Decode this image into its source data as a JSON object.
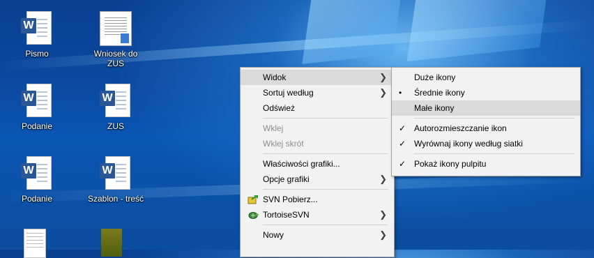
{
  "desktop_icons": [
    {
      "label": "Pismo",
      "kind": "word"
    },
    {
      "label": "Wniosek do ZUS",
      "kind": "preview"
    },
    {
      "label": "Podanie",
      "kind": "word"
    },
    {
      "label": "ZUS",
      "kind": "word"
    },
    {
      "label": "Podanie",
      "kind": "word"
    },
    {
      "label": "Szablon - treść",
      "kind": "word"
    }
  ],
  "context_menu": {
    "items": [
      {
        "label": "Widok",
        "has_submenu": true,
        "highlighted": true
      },
      {
        "label": "Sortuj według",
        "has_submenu": true
      },
      {
        "label": "Odśwież"
      },
      {
        "label": "Wklej",
        "disabled": true
      },
      {
        "label": "Wklej skrót",
        "disabled": true
      },
      {
        "label": "Właściwości grafiki..."
      },
      {
        "label": "Opcje grafiki",
        "has_submenu": true
      },
      {
        "label": "SVN Pobierz...",
        "icon": "svn-checkout-icon"
      },
      {
        "label": "TortoiseSVN",
        "icon": "tortoisesvn-icon",
        "has_submenu": true
      },
      {
        "label": "Nowy",
        "has_submenu": true
      }
    ]
  },
  "view_submenu": {
    "items": [
      {
        "label": "Duże ikony"
      },
      {
        "label": "Średnie ikony",
        "mark": "•",
        "selected": true
      },
      {
        "label": "Małe ikony",
        "highlighted": true
      },
      {
        "label": "Autorozmieszczanie ikon",
        "mark": "✓"
      },
      {
        "label": "Wyrównaj ikony według siatki",
        "mark": "✓"
      },
      {
        "label": "Pokaż ikony pulpitu",
        "mark": "✓"
      }
    ]
  },
  "glyphs": {
    "word_letter": "W",
    "submenu_arrow": "❯"
  }
}
